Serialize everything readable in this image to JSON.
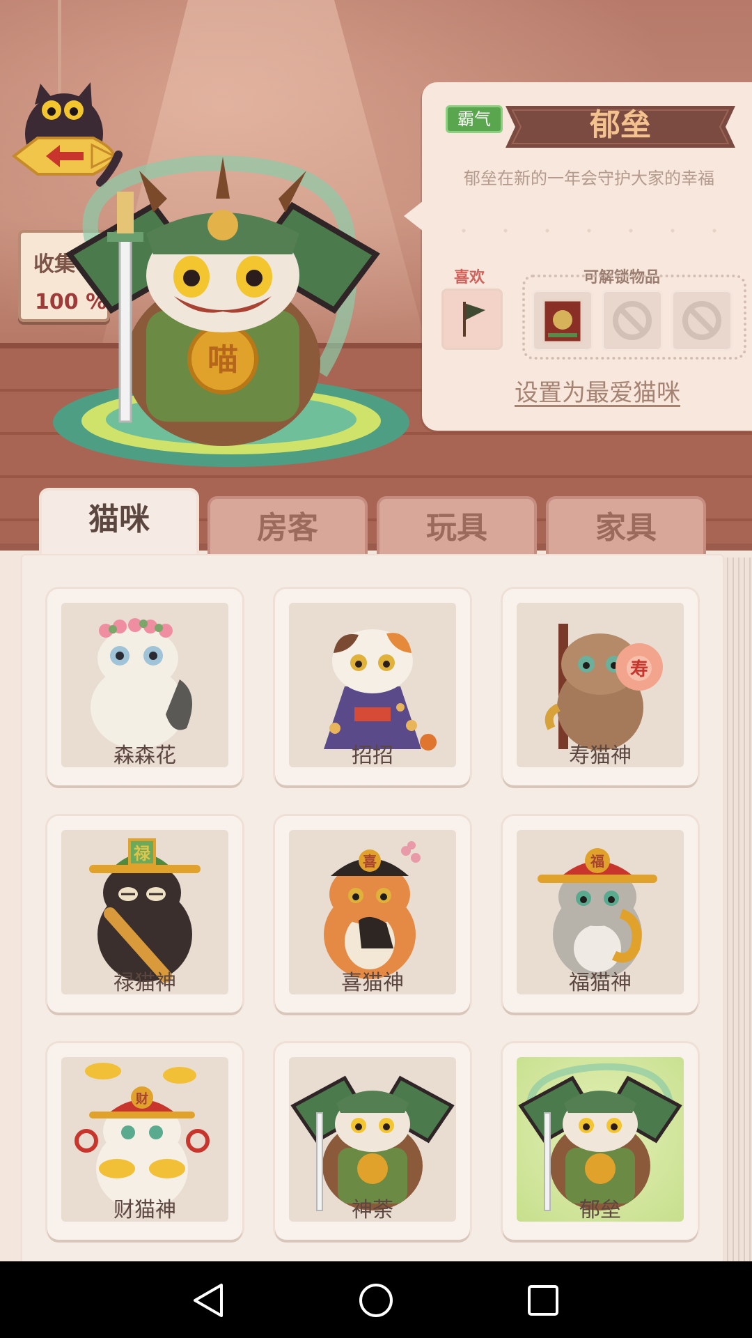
{
  "scene": {
    "collection": {
      "label": "收集",
      "percent": "100 %"
    }
  },
  "detail": {
    "trait": "霸气",
    "name": "郁垒",
    "description": "郁垒在新的一年会守护大家的幸福",
    "like_label": "喜欢",
    "unlock_label": "可解锁物品",
    "favorite_button": "设置为最爱猫咪"
  },
  "tabs": [
    {
      "label": "猫咪",
      "active": true
    },
    {
      "label": "房客",
      "active": false
    },
    {
      "label": "玩具",
      "active": false
    },
    {
      "label": "家具",
      "active": false
    }
  ],
  "cats": [
    {
      "name": "森森花"
    },
    {
      "name": "招招"
    },
    {
      "name": "寿猫神"
    },
    {
      "name": "禄猫神"
    },
    {
      "name": "喜猫神"
    },
    {
      "name": "福猫神"
    },
    {
      "name": "财猫神"
    },
    {
      "name": "神荼"
    },
    {
      "name": "郁垒",
      "selected": true
    }
  ],
  "colors": {
    "trait_badge": "#5aa64e",
    "ribbon": "#7b4a40",
    "tab_active": "#f6ebe4",
    "tab_inactive": "#d9a79a",
    "selected_card": "#c6df8d"
  },
  "icons": {
    "back": "back-arrow-icon",
    "like_item": "flag-icon",
    "locked": "locked-slot-icon",
    "nav_back": "triangle-back-icon",
    "nav_home": "circle-home-icon",
    "nav_recent": "square-recent-icon"
  }
}
